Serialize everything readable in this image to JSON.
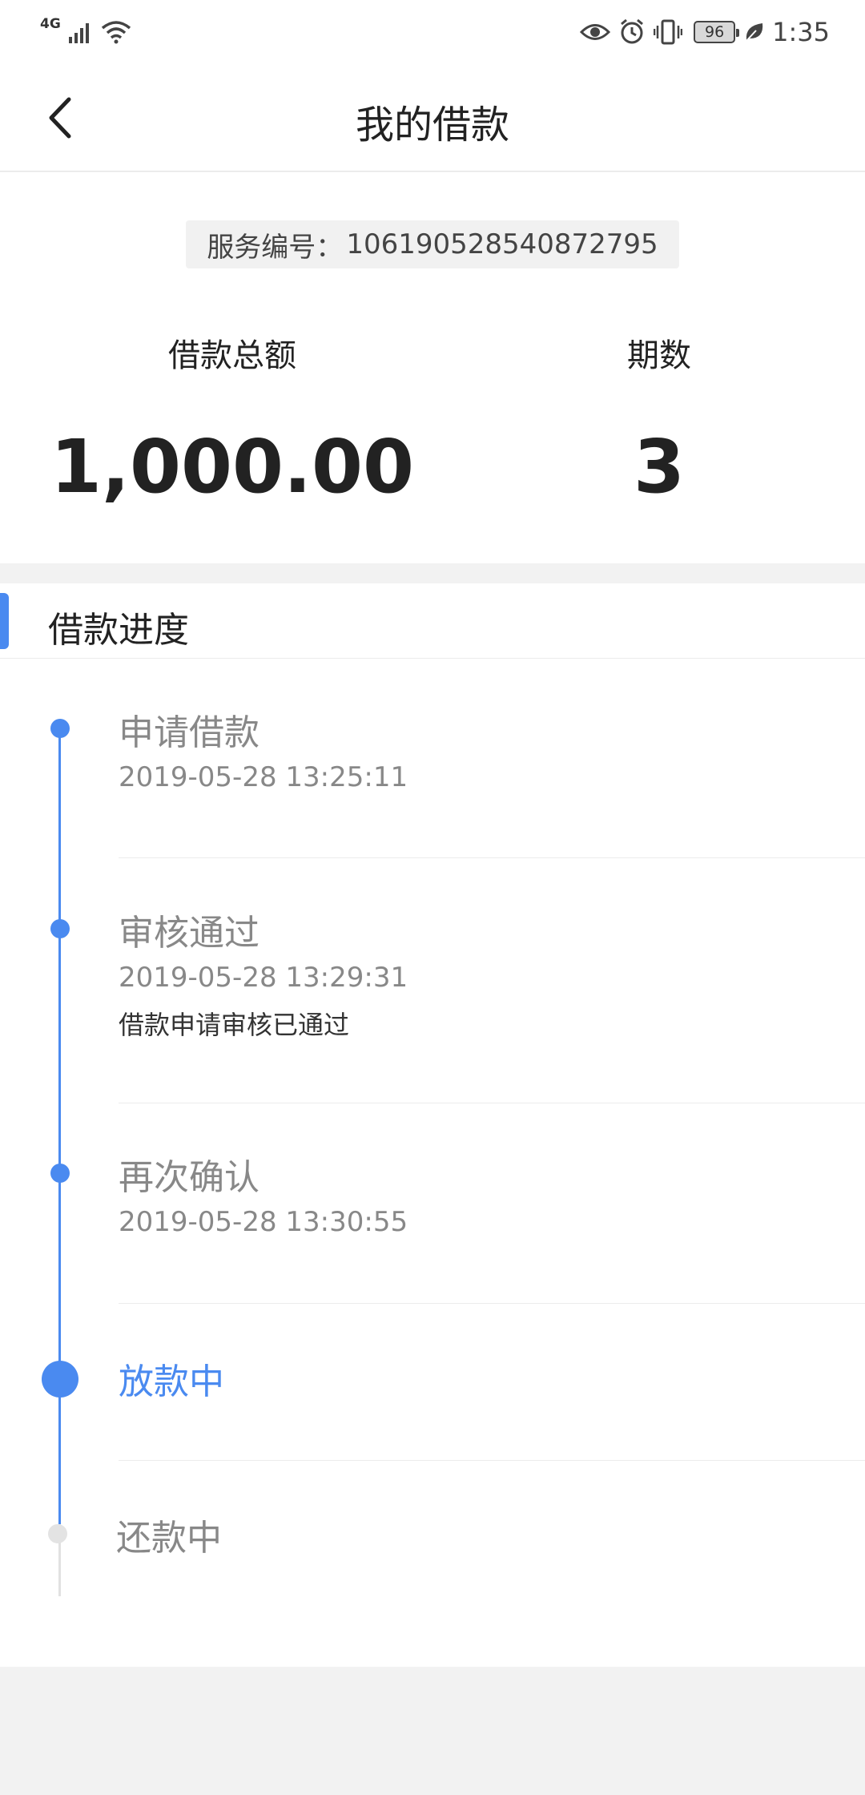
{
  "status_bar": {
    "network": "4G",
    "battery": "96",
    "time": "1:35",
    "icons": [
      "signal-icon",
      "wifi-icon",
      "eye-icon",
      "alarm-icon",
      "vibrate-icon",
      "battery-icon",
      "leaf-icon"
    ]
  },
  "nav": {
    "title": "我的借款",
    "back_icon": "chevron-left-icon"
  },
  "summary": {
    "service_label": "服务编号：",
    "service_number": "106190528540872795",
    "total_label": "借款总额",
    "total_value": "1,000.00",
    "term_label": "期数",
    "term_value": "3"
  },
  "progress": {
    "title": "借款进度",
    "accent_color": "#4a8af0",
    "steps": [
      {
        "name": "申请借款",
        "time": "2019-05-28 13:25:11",
        "note": ""
      },
      {
        "name": "审核通过",
        "time": "2019-05-28 13:29:31",
        "note": "借款申请审核已通过"
      },
      {
        "name": "再次确认",
        "time": "2019-05-28 13:30:55",
        "note": ""
      },
      {
        "name": "放款中",
        "time": "",
        "note": ""
      },
      {
        "name": "还款中",
        "time": "",
        "note": ""
      }
    ]
  }
}
